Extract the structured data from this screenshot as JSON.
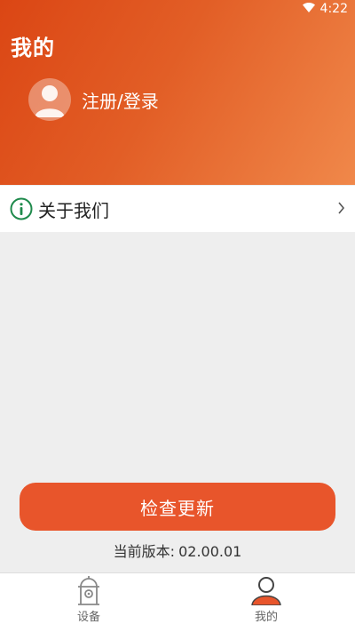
{
  "status_bar": {
    "time": "4:22",
    "wifi_icon": "wifi-icon",
    "battery_icon": "battery-icon"
  },
  "header": {
    "title": "我的",
    "avatar_icon": "person-icon",
    "login_label": "注册/登录"
  },
  "menu": [
    {
      "icon": "info-icon",
      "label": "关于我们",
      "chevron_icon": "chevron-right-icon"
    }
  ],
  "update": {
    "button_label": "检查更新",
    "version_prefix": "当前版本:",
    "version_value": "02.00.01"
  },
  "bottom_nav": {
    "tabs": [
      {
        "icon": "device-icon",
        "label": "设备",
        "active": false
      },
      {
        "icon": "person-icon",
        "label": "我的",
        "active": true
      }
    ]
  },
  "colors": {
    "accent": "#e8552b",
    "header_gradient_start": "#db4614",
    "header_gradient_end": "#f0884a",
    "info_icon": "#1f8a4c",
    "background": "#eeeeee"
  }
}
